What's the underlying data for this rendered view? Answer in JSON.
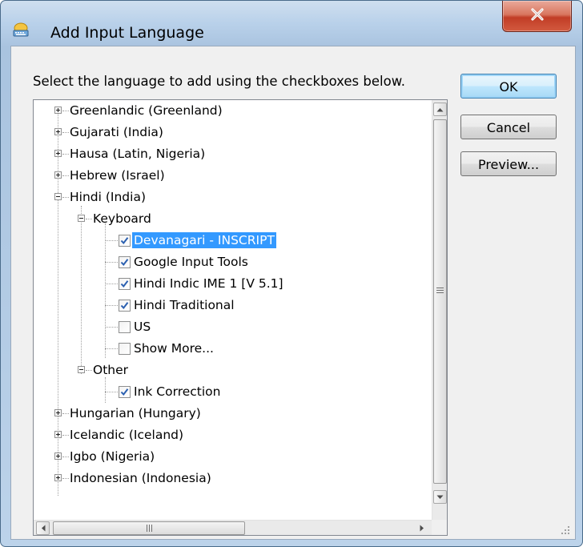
{
  "window": {
    "title": "Add Input Language",
    "close_label": "X"
  },
  "dialog": {
    "instruction": "Select the language to add using the checkboxes below.",
    "buttons": {
      "ok": "OK",
      "cancel": "Cancel",
      "preview": "Preview..."
    }
  },
  "tree": {
    "languages_before": [
      "Greenlandic (Greenland)",
      "Gujarati (India)",
      "Hausa (Latin, Nigeria)",
      "Hebrew (Israel)"
    ],
    "expanded_language": "Hindi (India)",
    "keyboard_group": "Keyboard",
    "keyboards": [
      {
        "label": "Devanagari - INSCRIPT",
        "checked": true,
        "selected": true
      },
      {
        "label": "Google Input Tools",
        "checked": true,
        "selected": false
      },
      {
        "label": "Hindi Indic IME 1 [V 5.1]",
        "checked": true,
        "selected": false
      },
      {
        "label": "Hindi Traditional",
        "checked": true,
        "selected": false
      },
      {
        "label": "US",
        "checked": false,
        "selected": false
      },
      {
        "label": "Show More...",
        "checked": false,
        "selected": false
      }
    ],
    "other_group": "Other",
    "other_items": [
      {
        "label": "Ink Correction",
        "checked": true
      }
    ],
    "languages_after": [
      "Hungarian (Hungary)",
      "Icelandic (Iceland)",
      "Igbo (Nigeria)",
      "Indonesian (Indonesia)"
    ]
  },
  "colors": {
    "selection": "#3399ff",
    "close_button": "#c13d26",
    "check": "#2a5fb0"
  },
  "icons": [
    "language-globe-icon",
    "close-icon",
    "expand-icon",
    "collapse-icon",
    "checkbox-check-icon",
    "scroll-up-arrow-icon",
    "scroll-down-arrow-icon",
    "scroll-left-arrow-icon",
    "scroll-right-arrow-icon",
    "resize-grip-icon"
  ]
}
